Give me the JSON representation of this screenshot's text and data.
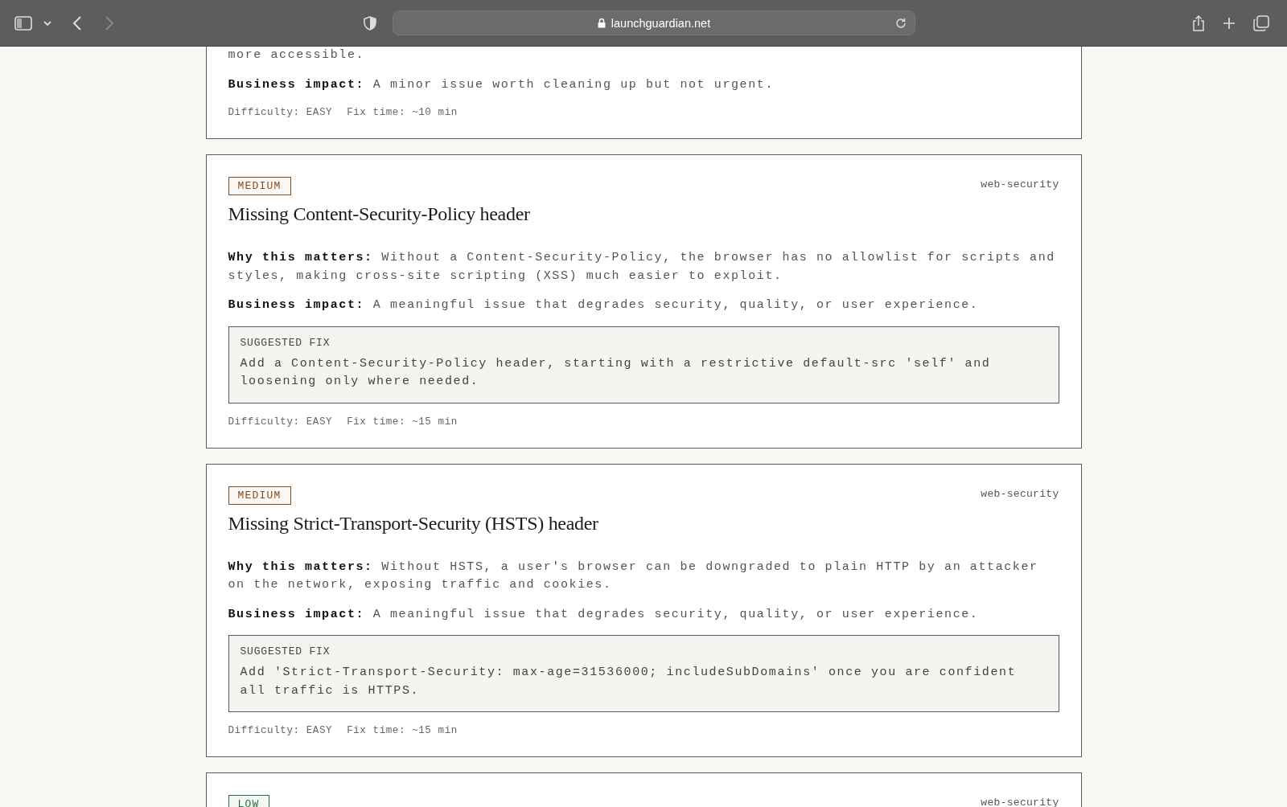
{
  "browser": {
    "url": "launchguardian.net",
    "forward_disabled": true
  },
  "cards": [
    {
      "kind": "partial-top",
      "why_tail": "more accessible.",
      "impact": "**Business impact:** A minor issue worth cleaning up but not urgent.",
      "difficulty": "Difficulty: EASY",
      "fix_time": "Fix time: ~10 min"
    },
    {
      "kind": "full",
      "severity": "MEDIUM",
      "color": "#8a4a1c",
      "category": "web-security",
      "title": "Missing Content-Security-Policy header",
      "why": "**Why this matters:** Without a Content-Security-Policy, the browser has no allowlist for scripts and styles, making cross-site scripting (XSS) much easier to exploit.",
      "impact": "**Business impact:** A meaningful issue that degrades security, quality, or user experience.",
      "fix_label": "SUGGESTED FIX",
      "fix": "Add a Content-Security-Policy header, starting with a restrictive default-src 'self' and loosening only where needed.",
      "difficulty": "Difficulty: EASY",
      "fix_time": "Fix time: ~15 min"
    },
    {
      "kind": "full",
      "severity": "MEDIUM",
      "color": "#8a4a1c",
      "category": "web-security",
      "title": "Missing Strict-Transport-Security (HSTS) header",
      "why": "**Why this matters:** Without HSTS, a user's browser can be downgraded to plain HTTP by an attacker on the network, exposing traffic and cookies.",
      "impact": "**Business impact:** A meaningful issue that degrades security, quality, or user experience.",
      "fix_label": "SUGGESTED FIX",
      "fix": "Add 'Strict-Transport-Security: max-age=31536000; includeSubDomains' once you are confident all traffic is HTTPS.",
      "difficulty": "Difficulty: EASY",
      "fix_time": "Fix time: ~15 min"
    },
    {
      "kind": "partial-bottom",
      "severity": "LOW",
      "color": "#2f6e3c",
      "category": "web-security"
    }
  ]
}
